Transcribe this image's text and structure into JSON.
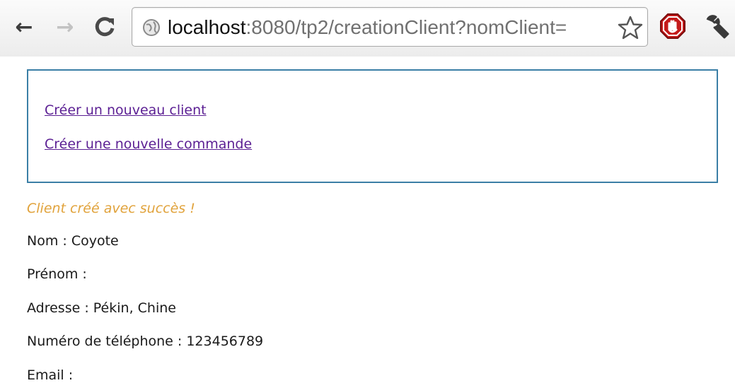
{
  "browser": {
    "url_host": "localhost",
    "url_rest": ":8080/tp2/creationClient?nomClient=",
    "icons": {
      "back": "arrow-left-icon",
      "forward": "arrow-right-icon",
      "reload": "reload-icon",
      "site": "globe-icon",
      "bookmark": "star-icon",
      "extension": "stop-sign-icon",
      "menu": "wrench-icon"
    }
  },
  "menu": {
    "links": [
      {
        "label": "Créer un nouveau client"
      },
      {
        "label": "Créer une nouvelle commande"
      }
    ]
  },
  "result": {
    "message": "Client créé avec succès !",
    "message_color": "#e1a33c",
    "fields": [
      {
        "text": "Nom : Coyote"
      },
      {
        "text": "Prénom :"
      },
      {
        "text": "Adresse : Pékin, Chine"
      },
      {
        "text": "Numéro de téléphone : 123456789"
      },
      {
        "text": "Email :"
      }
    ]
  },
  "colors": {
    "link": "#5b1f93",
    "box_border": "#3b7fa6"
  }
}
